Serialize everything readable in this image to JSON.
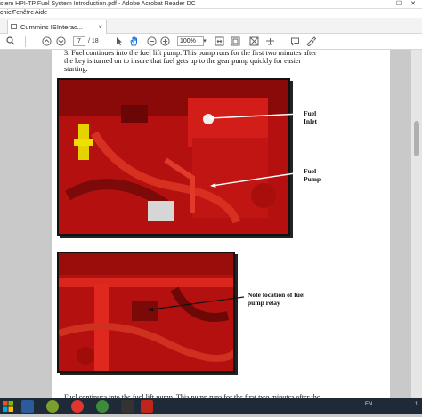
{
  "window": {
    "title": "stem HPI-TP Fuel System Introduction.pdf - Adobe Acrobat Reader DC",
    "minimize": "—",
    "maximize": "☐",
    "close": "✕"
  },
  "menu": [
    "chier",
    "Fenêtre",
    "Aide"
  ],
  "tab": {
    "label": "Cummins ISInterac...",
    "close": "×"
  },
  "toolbar": {
    "home": "⌂",
    "search": "⚲",
    "page_current": "7",
    "page_total": "/ 18",
    "zoom": "100%",
    "icons": [
      "search-icon",
      "up-icon",
      "down-icon",
      "pointer-icon",
      "hand-icon",
      "zoom-out-icon",
      "zoom-in-icon",
      "zoom-dropdown-icon",
      "fit-width-icon",
      "fit-page-icon",
      "scroll-mode-icon",
      "read-mode-icon",
      "comment-icon",
      "sign-icon"
    ]
  },
  "document": {
    "para1": [
      "3. Fuel continues into the fuel lift pump. This pump runs for the first two minutes after",
      "the key is turned on to insure that fuel gets up to the gear pump quickly for easier",
      "starting."
    ],
    "callouts": {
      "fuel_inlet": [
        "Fuel",
        "Inlet"
      ],
      "fuel_pump": [
        "Fuel",
        "Pump"
      ],
      "relay": [
        "Note location of fuel",
        "pump relay"
      ]
    },
    "para2": "Fuel continues into the fuel lift pump. This pump runs for the first two minutes after the"
  },
  "taskbar": {
    "icons": [
      "start-icon",
      "media-player-icon",
      "chrome-icon",
      "folder-icon",
      "acrobat-icon",
      "paint-icon"
    ],
    "lang": "EN",
    "time": "1"
  }
}
